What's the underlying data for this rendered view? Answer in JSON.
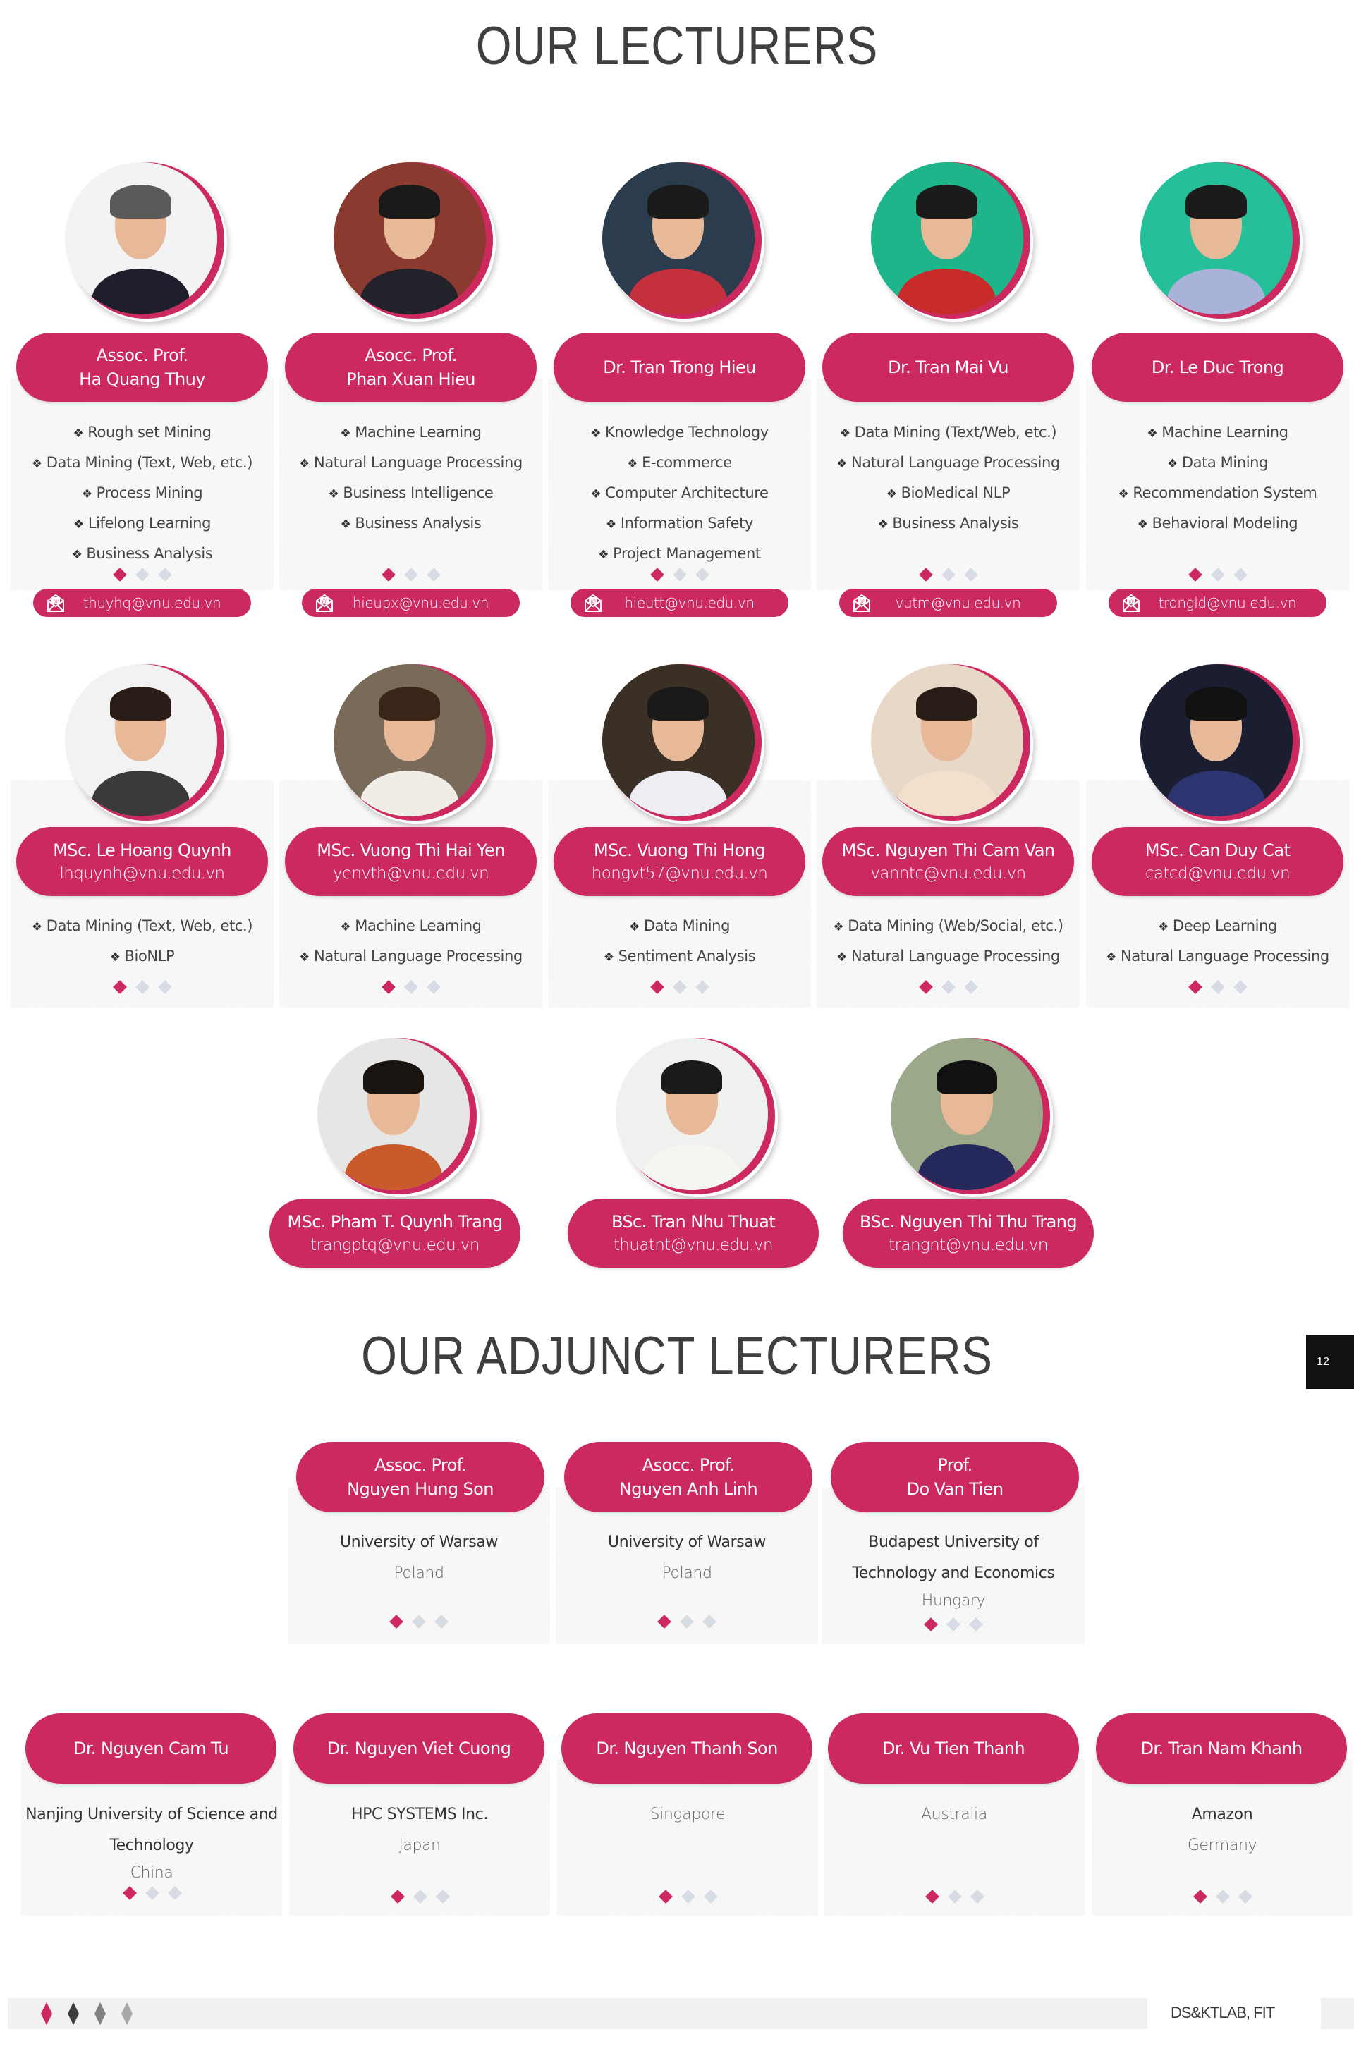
{
  "titles": {
    "main": "OUR LECTURERS",
    "adjunct": "OUR ADJUNCT LECTURERS"
  },
  "page_number": "12",
  "accent_color": "#cc2a5e",
  "lecturers_row1": [
    {
      "title": "Assoc. Prof.",
      "name": "Ha Quang Thuy",
      "topics": [
        "Rough set Mining",
        "Data Mining (Text, Web, etc.)",
        "Process Mining",
        "Lifelong Learning",
        "Business Analysis"
      ],
      "email": "thuyhq@vnu.edu.vn"
    },
    {
      "title": "Asocc. Prof.",
      "name": "Phan Xuan Hieu",
      "topics": [
        "Machine Learning",
        "Natural Language Processing",
        "Business Intelligence",
        "Business Analysis"
      ],
      "email": "hieupx@vnu.edu.vn"
    },
    {
      "title": "",
      "name": "Dr. Tran Trong Hieu",
      "topics": [
        "Knowledge Technology",
        "E-commerce",
        "Computer Architecture",
        "Information Safety",
        "Project Management"
      ],
      "email": "hieutt@vnu.edu.vn"
    },
    {
      "title": "",
      "name": "Dr. Tran Mai Vu",
      "topics": [
        "Data Mining (Text/Web, etc.)",
        "Natural Language Processing",
        "BioMedical NLP",
        "Business Analysis"
      ],
      "email": "vutm@vnu.edu.vn"
    },
    {
      "title": "",
      "name": "Dr. Le Duc Trong",
      "topics": [
        "Machine Learning",
        "Data Mining",
        "Recommendation System",
        "Behavioral Modeling"
      ],
      "email": "trongld@vnu.edu.vn"
    }
  ],
  "lecturers_row2": [
    {
      "name": "MSc. Le Hoang Quynh",
      "email": "lhquynh@vnu.edu.vn",
      "topics": [
        "Data Mining (Text, Web, etc.)",
        "BioNLP"
      ]
    },
    {
      "name": "MSc. Vuong Thi Hai Yen",
      "email": "yenvth@vnu.edu.vn",
      "topics": [
        "Machine Learning",
        "Natural Language Processing"
      ]
    },
    {
      "name": "MSc. Vuong Thi Hong",
      "email": "hongvt57@vnu.edu.vn",
      "topics": [
        "Data Mining",
        "Sentiment Analysis"
      ]
    },
    {
      "name": "MSc. Nguyen Thi Cam Van",
      "email": "vanntc@vnu.edu.vn",
      "topics": [
        "Data Mining (Web/Social, etc.)",
        "Natural Language Processing"
      ]
    },
    {
      "name": "MSc. Can Duy Cat",
      "email": "catcd@vnu.edu.vn",
      "topics": [
        "Deep Learning",
        "Natural Language Processing"
      ]
    }
  ],
  "lecturers_row3": [
    {
      "name": "MSc. Pham T. Quynh Trang",
      "email": "trangptq@vnu.edu.vn"
    },
    {
      "name": "BSc. Tran Nhu Thuat",
      "email": "thuatnt@vnu.edu.vn"
    },
    {
      "name": "BSc. Nguyen Thi Thu Trang",
      "email": "trangnt@vnu.edu.vn"
    }
  ],
  "adjunct_row1": [
    {
      "title": "Assoc. Prof.",
      "name": "Nguyen Hung Son",
      "org": [
        "University of Warsaw"
      ],
      "country": "Poland"
    },
    {
      "title": "Asocc. Prof.",
      "name": "Nguyen Anh Linh",
      "org": [
        "University of Warsaw"
      ],
      "country": "Poland"
    },
    {
      "title": "Prof.",
      "name": "Do Van Tien",
      "org": [
        "Budapest University of",
        "Technology and Economics"
      ],
      "country": "Hungary"
    }
  ],
  "adjunct_row2": [
    {
      "name": "Dr. Nguyen Cam Tu",
      "org": [
        "Nanjing University of Science and",
        "Technology"
      ],
      "country": "China"
    },
    {
      "name": "Dr. Nguyen Viet Cuong",
      "org": [
        "HPC SYSTEMS Inc."
      ],
      "country": "Japan"
    },
    {
      "name": "Dr. Nguyen Thanh Son",
      "org": [],
      "country": "Singapore"
    },
    {
      "name": "Dr. Vu Tien Thanh",
      "org": [],
      "country": "Australia"
    },
    {
      "name": "Dr. Tran Nam Khanh",
      "org": [
        "Amazon"
      ],
      "country": "Germany"
    }
  ],
  "carousel": {
    "active_index": 0,
    "count": 3
  },
  "footer": {
    "text": "DS&KTLAB, FIT",
    "diamond_colors": [
      "#cc2a5e",
      "#3d3d3d",
      "#828282",
      "#a8a8a8"
    ]
  },
  "avatar_palettes": [
    {
      "bg": "#f3f3f3",
      "body": "#1e1f2a",
      "hair": "#5a5a5a"
    },
    {
      "bg": "#8a3a2e",
      "body": "#22222a",
      "hair": "#1a1a1a"
    },
    {
      "bg": "#2b3c4e",
      "body": "#c4303c",
      "hair": "#1b1b1b"
    },
    {
      "bg": "#1fb58a",
      "body": "#c92b2b",
      "hair": "#1b1b1b"
    },
    {
      "bg": "#25bf9a",
      "body": "#a9b3d9",
      "hair": "#1b1b1b"
    },
    {
      "bg": "#f2f2f2",
      "body": "#3a3a3a",
      "hair": "#2a1c16"
    },
    {
      "bg": "#7a6a5a",
      "body": "#f0ece6",
      "hair": "#3a2618"
    },
    {
      "bg": "#3b3026",
      "body": "#eceef4",
      "hair": "#1a1a1a"
    },
    {
      "bg": "#e8d8c8",
      "body": "#f2e0cc",
      "hair": "#2a1c16"
    },
    {
      "bg": "#1b1d30",
      "body": "#2d3570",
      "hair": "#111111"
    },
    {
      "bg": "#e6e6e6",
      "body": "#c95a2c",
      "hair": "#1a1410"
    },
    {
      "bg": "#eef1ee",
      "body": "#f5f5f2",
      "hair": "#1a1a1a"
    },
    {
      "bg": "#9ba88a",
      "body": "#25285a",
      "hair": "#111111"
    }
  ]
}
